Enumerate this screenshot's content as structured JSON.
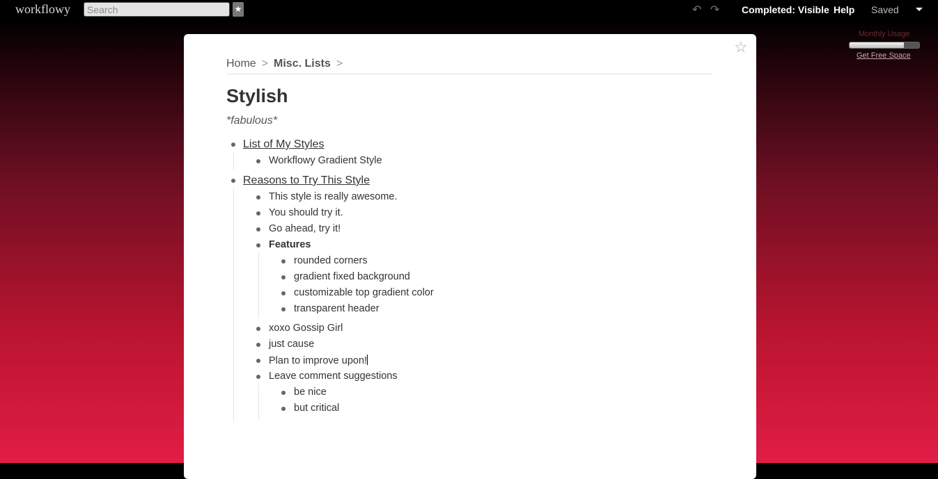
{
  "topbar": {
    "logo": "workflowy",
    "search_placeholder": "Search",
    "star_label": "★",
    "undo_label": "↶",
    "redo_label": "↷",
    "completed_label": "Completed: Visible",
    "help_label": "Help",
    "saved_label": "Saved"
  },
  "usage": {
    "label": "Monthly Usage",
    "link": "Get Free Space",
    "fill_fraction": 0.78
  },
  "page": {
    "star_label": "☆",
    "breadcrumb": {
      "home": "Home",
      "sep": ">",
      "parent": "Misc. Lists",
      "trail": ">"
    },
    "title": "Stylish",
    "note": "*fabulous*",
    "items": [
      {
        "text": "List of My Styles"
      },
      {
        "text": "Workflowy Gradient Style"
      },
      {
        "text": "Reasons to Try This Style"
      },
      {
        "text": "This style is really awesome."
      },
      {
        "text": "You should try it."
      },
      {
        "text": "Go ahead, try it!"
      },
      {
        "text": "Features"
      },
      {
        "text": "rounded corners"
      },
      {
        "text": "gradient fixed background"
      },
      {
        "text": "customizable top gradient color"
      },
      {
        "text": "transparent header"
      },
      {
        "text": "xoxo Gossip Girl"
      },
      {
        "text": "just cause"
      },
      {
        "text": "Plan to improve upon!"
      },
      {
        "text": "Leave comment suggestions"
      },
      {
        "text": "be nice"
      },
      {
        "text": "but critical"
      }
    ]
  }
}
